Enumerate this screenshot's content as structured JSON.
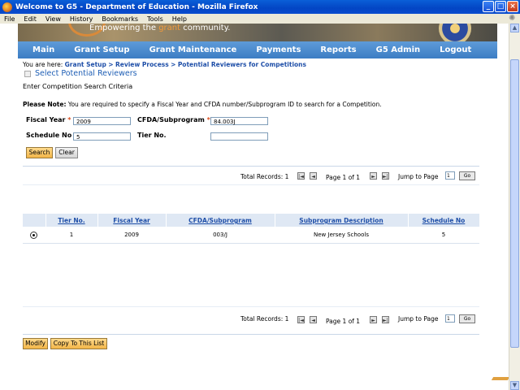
{
  "window": {
    "title": "Welcome to G5 - Department of Education - Mozilla Firefox",
    "minimize": "_",
    "maximize": "□",
    "close": "×"
  },
  "menu": [
    "File",
    "Edit",
    "View",
    "History",
    "Bookmarks",
    "Tools",
    "Help"
  ],
  "banner": {
    "tagline_pre": "Empowering the ",
    "tagline_accent": "grant",
    "tagline_post": " community."
  },
  "nav": [
    "Main",
    "Grant Setup",
    "Grant Maintenance",
    "Payments",
    "Reports",
    "G5 Admin",
    "Logout"
  ],
  "breadcrumb": {
    "prefix": "You are here:",
    "items": [
      "Grant Setup",
      ">",
      "Review Process",
      ">",
      "Potential Reviewers for Competitions"
    ]
  },
  "section_title": "Select Potential Reviewers",
  "criteria_title": "Enter Competition Search Criteria",
  "note": {
    "bold": "Please Note:",
    "text": " You are required to specify a Fiscal Year and CFDA number/Subprogram ID to search for a Competition."
  },
  "form": {
    "fiscal_year_label": "Fiscal Year",
    "fiscal_year_value": "2009",
    "cfda_label": "CFDA/Subprogram",
    "cfda_value": "84.003J",
    "schedule_label": "Schedule No",
    "schedule_value": "5",
    "tier_label": "Tier No.",
    "tier_value": "",
    "required_mark": "*",
    "search_button": "Search",
    "clear_button": "Clear"
  },
  "pager": {
    "total_label": "Total Records: 1",
    "page_info": "Page 1 of 1",
    "jump_label": "Jump to Page",
    "jump_value": "1",
    "go": "Go",
    "first": "|◄",
    "prev": "◄",
    "next": "►",
    "last": "►|"
  },
  "table": {
    "headers": [
      "Tier No.",
      "Fiscal Year",
      "CFDA/Subprogram",
      "Subprogram Description",
      "Schedule No"
    ],
    "rows": [
      {
        "tier": "1",
        "fiscal_year": "2009",
        "cfda": "003/J",
        "description": "New Jersey Schools",
        "schedule": "5",
        "selected": true
      }
    ]
  },
  "actions": {
    "modify": "Modify",
    "copy": "Copy To This List"
  },
  "colors": {
    "nav_blue": "#3c7dc4",
    "link_blue": "#1f4fa8",
    "button_orange": "#f3b548",
    "required_red": "#d94b1b"
  }
}
